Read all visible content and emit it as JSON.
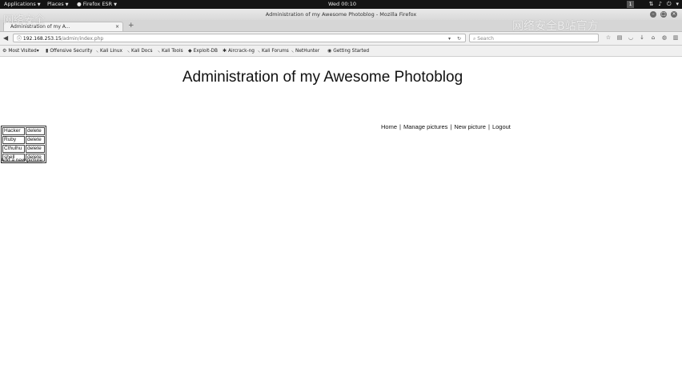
{
  "topbar": {
    "applications": "Applications",
    "places": "Places",
    "app_name": "Firefox ESR",
    "clock": "Wed 00:10",
    "workspace": "1"
  },
  "window": {
    "title": "Administration of my Awesome Photoblog - Mozilla Firefox"
  },
  "tab": {
    "label": "Administration of my A..."
  },
  "nav": {
    "url_host": "192.168.253.15",
    "url_path": "/admin/index.php",
    "search_placeholder": "Search"
  },
  "bookmarks": [
    {
      "label": "Most Visited",
      "icon": "gear-icon"
    },
    {
      "label": "Offensive Security",
      "icon": "offsec-icon"
    },
    {
      "label": "Kali Linux",
      "icon": "kali-icon"
    },
    {
      "label": "Kali Docs",
      "icon": "kali-icon"
    },
    {
      "label": "Kali Tools",
      "icon": "kali-icon"
    },
    {
      "label": "Exploit-DB",
      "icon": "exploitdb-icon"
    },
    {
      "label": "Aircrack-ng",
      "icon": "aircrack-icon"
    },
    {
      "label": "Kali Forums",
      "icon": "kali-icon"
    },
    {
      "label": "NetHunter",
      "icon": "kali-icon"
    },
    {
      "label": "Getting Started",
      "icon": "firefox-icon"
    }
  ],
  "watermark": {
    "right": "网络安全B站官方",
    "left": "网络安全"
  },
  "page": {
    "title": "Administration of my Awesome Photoblog",
    "menu": {
      "home": "Home",
      "manage": "Manage pictures",
      "new": "New picture",
      "logout": "Logout",
      "separator": "|"
    },
    "pictures": [
      {
        "name": "Hacker",
        "action": "delete"
      },
      {
        "name": "Ruby",
        "action": "delete"
      },
      {
        "name": "Cthulhu",
        "action": "delete"
      },
      {
        "name": "shell",
        "action": "delete"
      }
    ],
    "add_link": "Add a new picture"
  }
}
